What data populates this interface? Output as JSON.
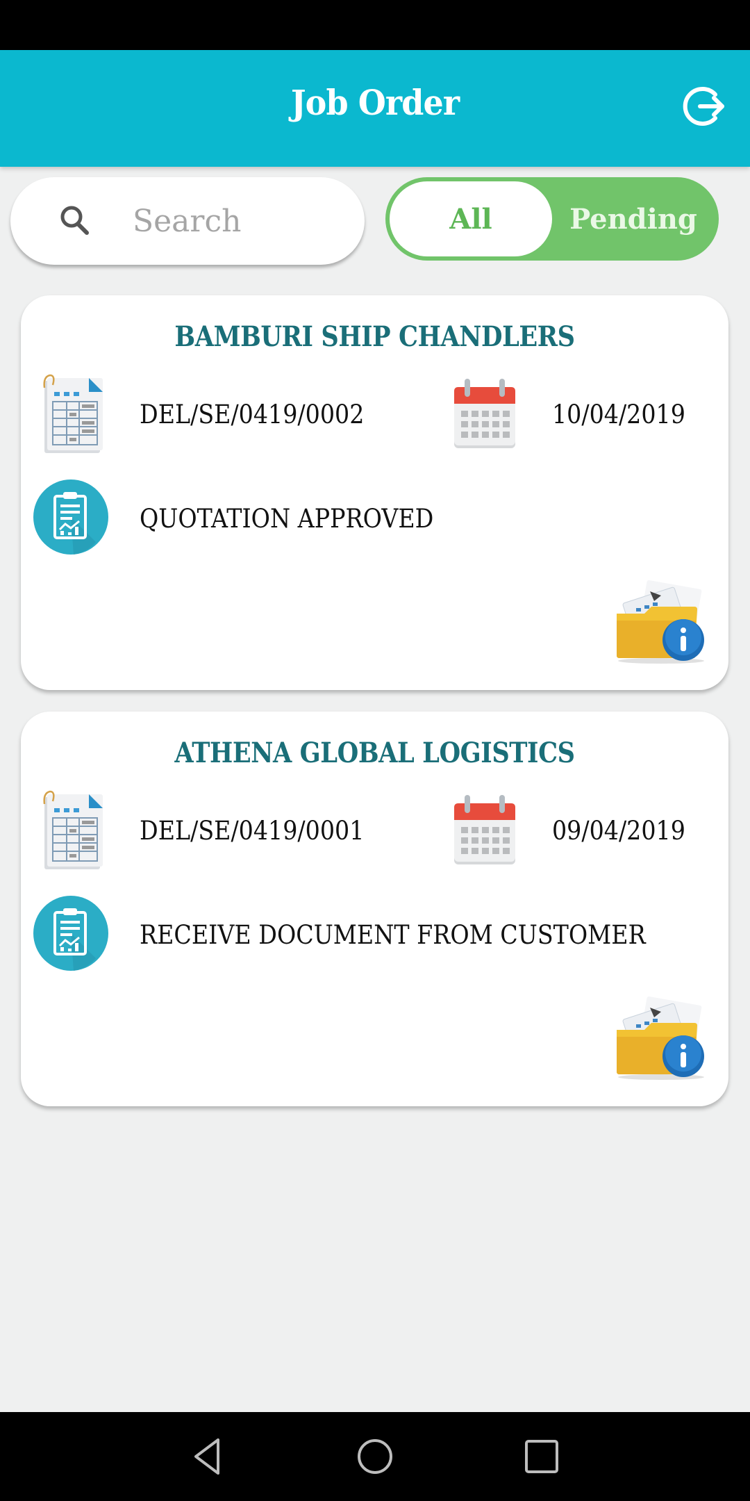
{
  "header": {
    "title": "Job Order",
    "logout_icon": "logout-icon"
  },
  "search": {
    "placeholder": "Search",
    "value": "",
    "icon": "search-icon"
  },
  "filter": {
    "options": [
      "All",
      "Pending"
    ],
    "selected": "All"
  },
  "colors": {
    "header": "#0BB8CF",
    "toggle_green": "#71C46A",
    "card_title": "#1A6E78",
    "background": "#EFF0F0"
  },
  "jobs": [
    {
      "company": "BAMBURI SHIP CHANDLERS",
      "job_number": "DEL/SE/0419/0002",
      "date": "10/04/2019",
      "status": "QUOTATION APPROVED",
      "icons": [
        "document-table-icon",
        "calendar-icon",
        "clipboard-chart-icon",
        "folder-info-icon"
      ]
    },
    {
      "company": "ATHENA GLOBAL LOGISTICS",
      "job_number": "DEL/SE/0419/0001",
      "date": "09/04/2019",
      "status": "RECEIVE DOCUMENT FROM CUSTOMER",
      "icons": [
        "document-table-icon",
        "calendar-icon",
        "clipboard-chart-icon",
        "folder-info-icon"
      ]
    }
  ],
  "nav": {
    "buttons": [
      "back",
      "home",
      "recents"
    ]
  }
}
